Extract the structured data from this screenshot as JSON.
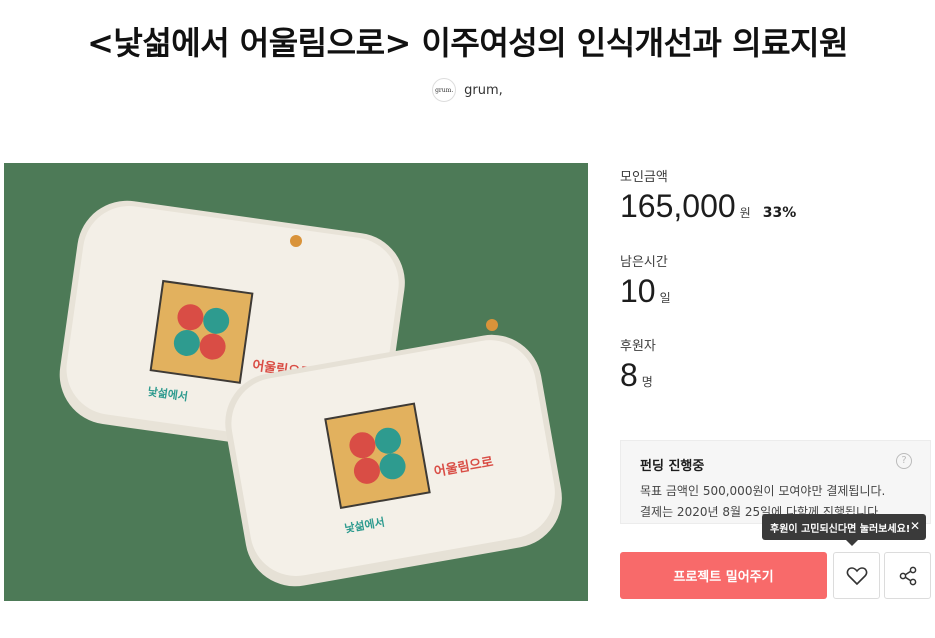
{
  "project": {
    "title": "<낯섦에서 어울림으로> 이주여성의 인식개선과 의료지원",
    "creator": {
      "avatar_text": "grum.",
      "name": "grum,"
    }
  },
  "photo": {
    "background": "#4d7a57",
    "products": [
      {
        "line_ko": "낯섦에서",
        "line_ko2": "어울림으로"
      },
      {
        "line_ko": "낯섦에서",
        "line_ko2": "어울림으로"
      }
    ]
  },
  "stats": {
    "amount": {
      "label": "모인금액",
      "value": "165,000",
      "unit": "원",
      "percent": "33%"
    },
    "time": {
      "label": "남은시간",
      "value": "10",
      "unit": "일"
    },
    "backers": {
      "label": "후원자",
      "value": "8",
      "unit": "명"
    }
  },
  "funding": {
    "title": "펀딩 진행중",
    "line1": "목표 금액인 500,000원이 모여야만 결제됩니다.",
    "line2": "결제는 2020년 8월 25일에 다함께 진행됩니다.",
    "help_icon": "question-icon"
  },
  "tooltip": {
    "text": "후원이 고민되신다면 눌러보세요!",
    "close": "✕"
  },
  "actions": {
    "back_label": "프로젝트 밀어주기",
    "back_color": "#f86a6a",
    "like_icon": "heart-icon",
    "share_icon": "share-icon"
  }
}
